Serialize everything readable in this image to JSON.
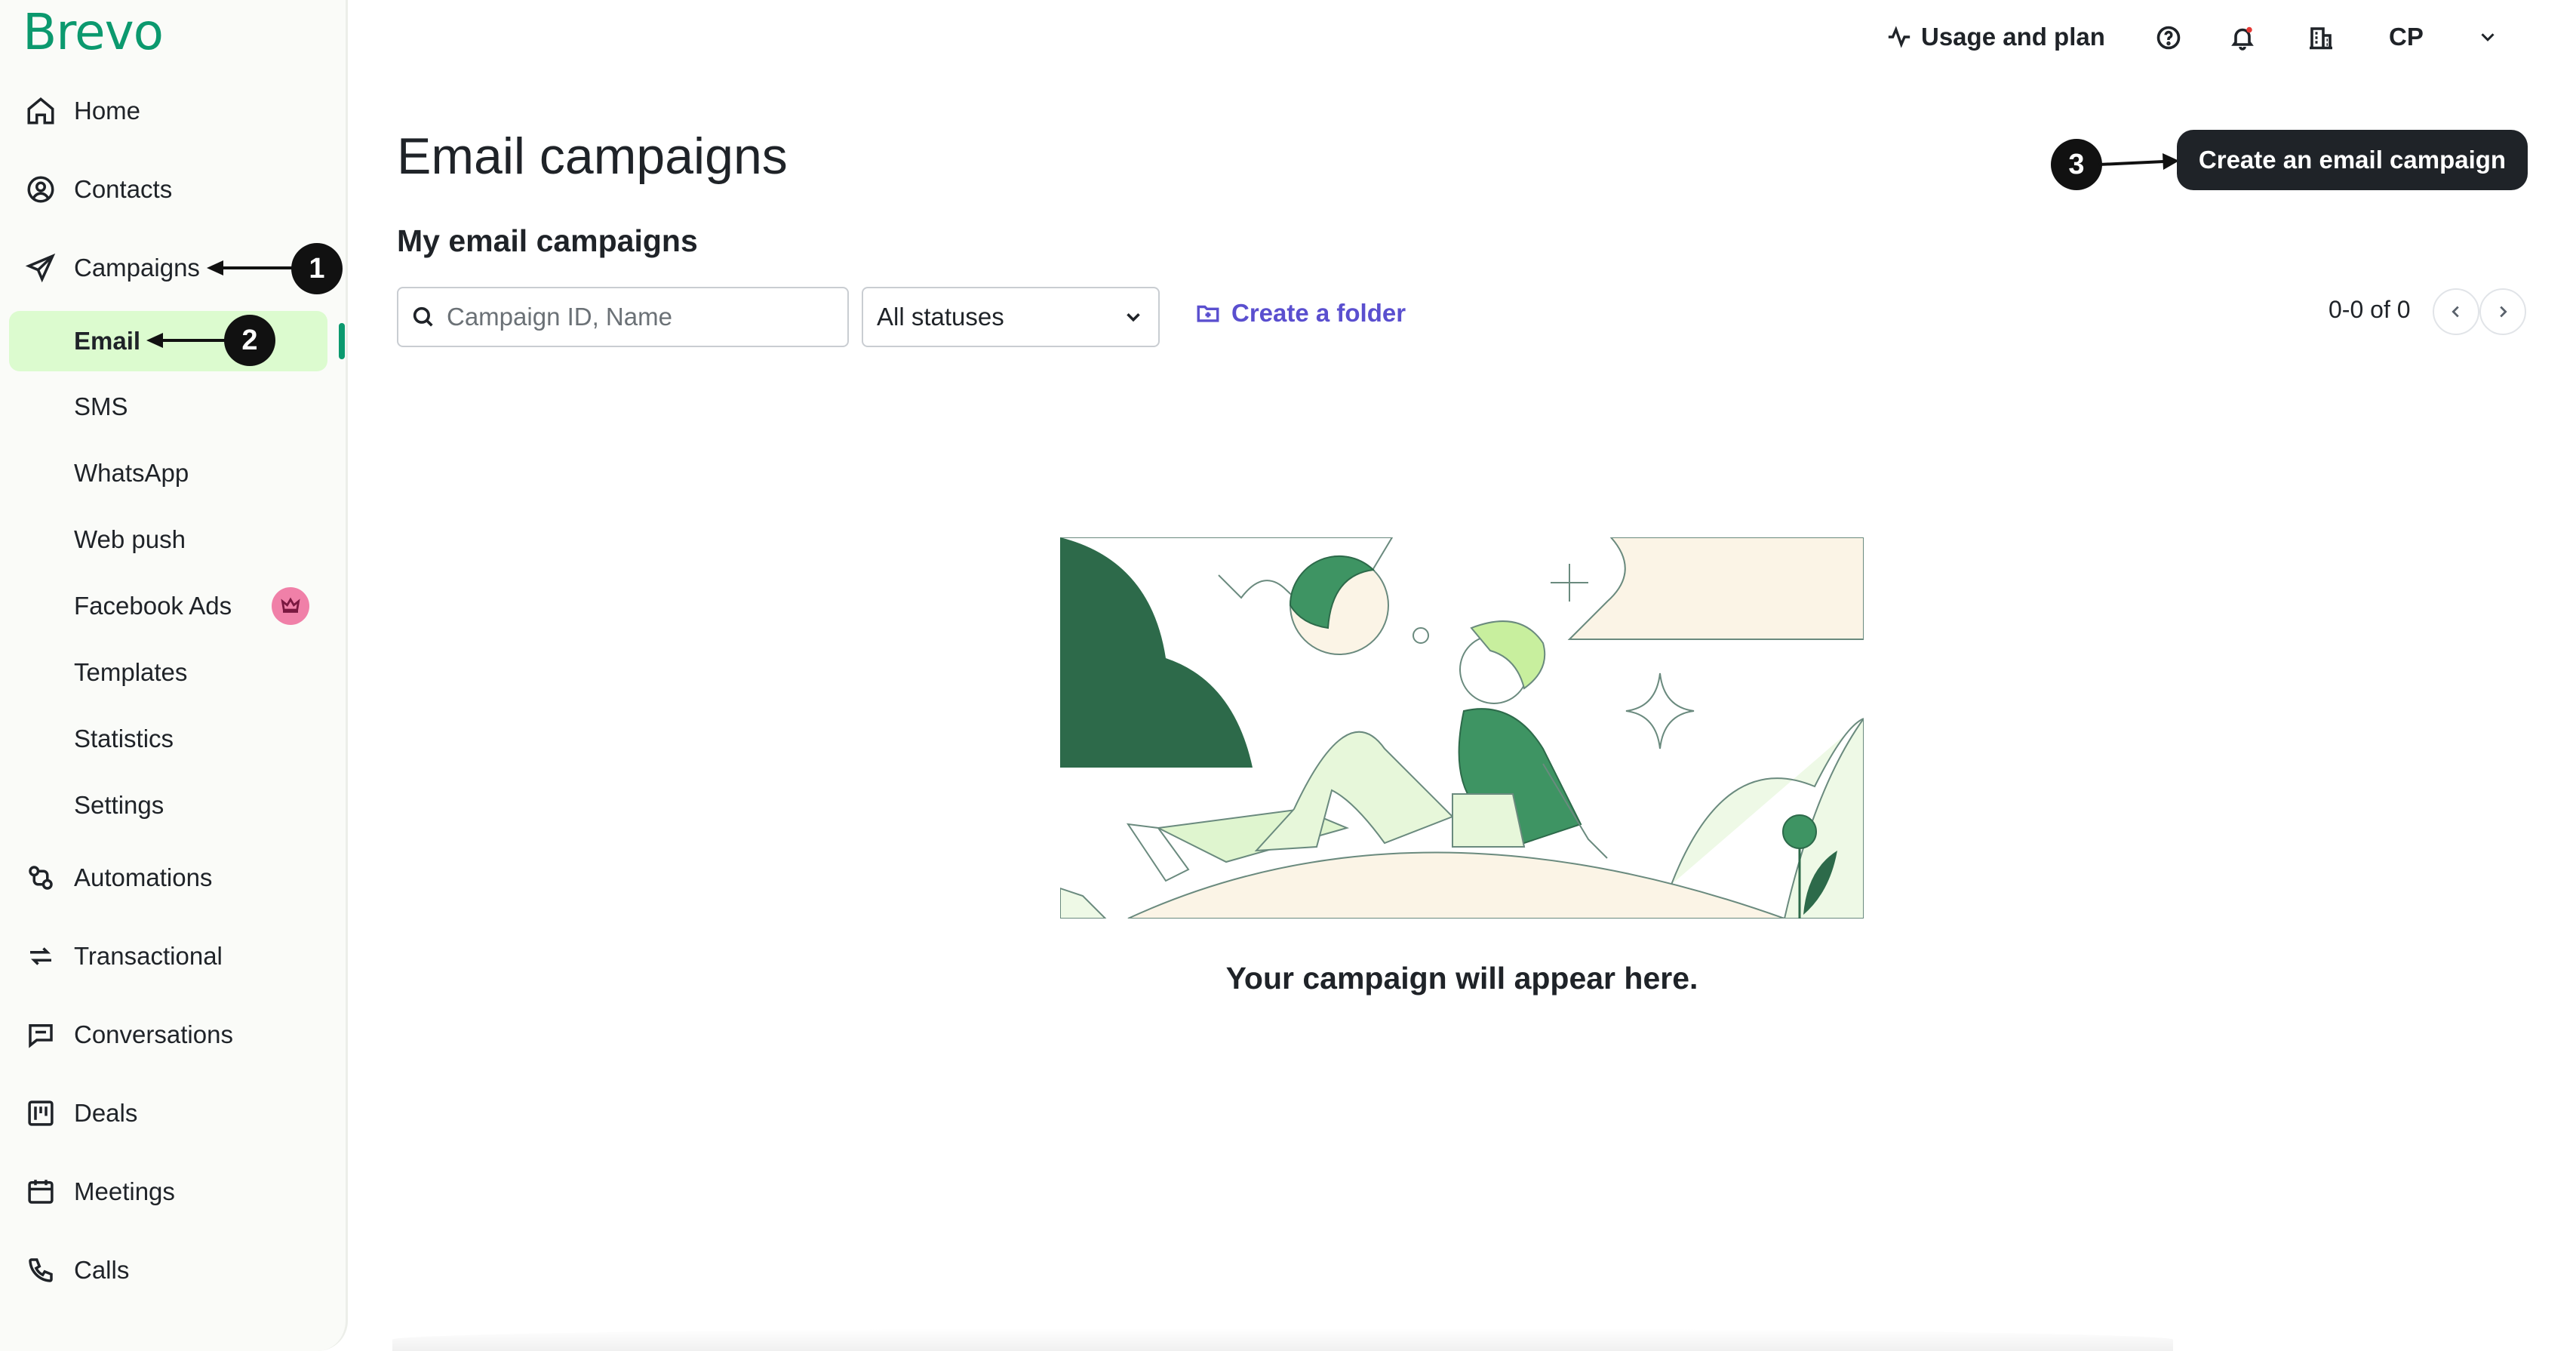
{
  "brand": {
    "logo_text": "Brevo",
    "accent": "#0b996e",
    "active_bg": "#dcfbcf",
    "link_color": "#5a4fcf"
  },
  "sidebar": {
    "items": [
      {
        "label": "Home",
        "icon": "home-icon"
      },
      {
        "label": "Contacts",
        "icon": "contacts-icon"
      },
      {
        "label": "Campaigns",
        "icon": "send-icon"
      },
      {
        "label": "Automations",
        "icon": "automations-icon"
      },
      {
        "label": "Transactional",
        "icon": "transactional-icon"
      },
      {
        "label": "Conversations",
        "icon": "conversations-icon"
      },
      {
        "label": "Deals",
        "icon": "deals-icon"
      },
      {
        "label": "Meetings",
        "icon": "calendar-icon"
      },
      {
        "label": "Calls",
        "icon": "phone-icon"
      }
    ],
    "campaign_subitems": [
      {
        "label": "Email",
        "active": true
      },
      {
        "label": "SMS"
      },
      {
        "label": "WhatsApp"
      },
      {
        "label": "Web push"
      },
      {
        "label": "Facebook Ads",
        "badge": "crown-icon"
      },
      {
        "label": "Templates"
      },
      {
        "label": "Statistics"
      },
      {
        "label": "Settings"
      }
    ]
  },
  "callouts": [
    "1",
    "2",
    "3"
  ],
  "topbar": {
    "usage_label": "Usage and plan",
    "account_initials": "CP"
  },
  "main": {
    "page_title": "Email campaigns",
    "section_title": "My email campaigns",
    "create_button": "Create an email campaign",
    "search_placeholder": "Campaign ID, Name",
    "status_filter": "All statuses",
    "create_folder": "Create a folder",
    "pagination": "0-0 of 0",
    "empty_message": "Your campaign will appear here."
  }
}
